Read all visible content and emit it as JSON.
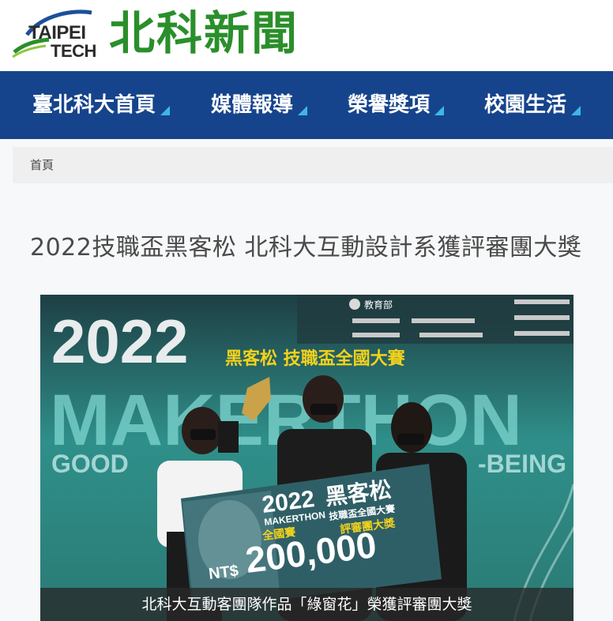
{
  "logo": {
    "line1": "TAIPEI",
    "line2": "TECH",
    "site_name": "北科新聞"
  },
  "nav": {
    "items": [
      {
        "label": "臺北科大首頁"
      },
      {
        "label": "媒體報導"
      },
      {
        "label": "榮譽獎項"
      },
      {
        "label": "校園生活"
      }
    ]
  },
  "breadcrumb": {
    "home": "首頁"
  },
  "article": {
    "title": "2022技職盃黑客松 北科大互動設計系獲評審團大獎",
    "photo": {
      "backdrop_year": "2022",
      "backdrop_subtitle": "黑客松 技職盃全國大賽",
      "backdrop_makerthon": "MAKERTHON",
      "backdrop_good": "GOOD",
      "backdrop_being": "-BEING",
      "sponsor_moe": "教育部",
      "sign_year": "2022",
      "sign_title": "黑客松",
      "sign_makerthon": "MAKERTHON",
      "sign_cup": "技職盃全國大賽",
      "sign_award": "評審團大獎",
      "sign_national": "全國賽",
      "sign_currency": "NT$",
      "sign_amount": "200,000",
      "caption": "北科大互動客團隊作品「綠窗花」榮獲評審團大獎"
    }
  },
  "colors": {
    "nav_bg": "#16448c",
    "nav_accent": "#3fb6e8",
    "brand_green": "#2a8f2a",
    "photo_teal": "#2f8f8a",
    "photo_yellow": "#f2d21c"
  }
}
